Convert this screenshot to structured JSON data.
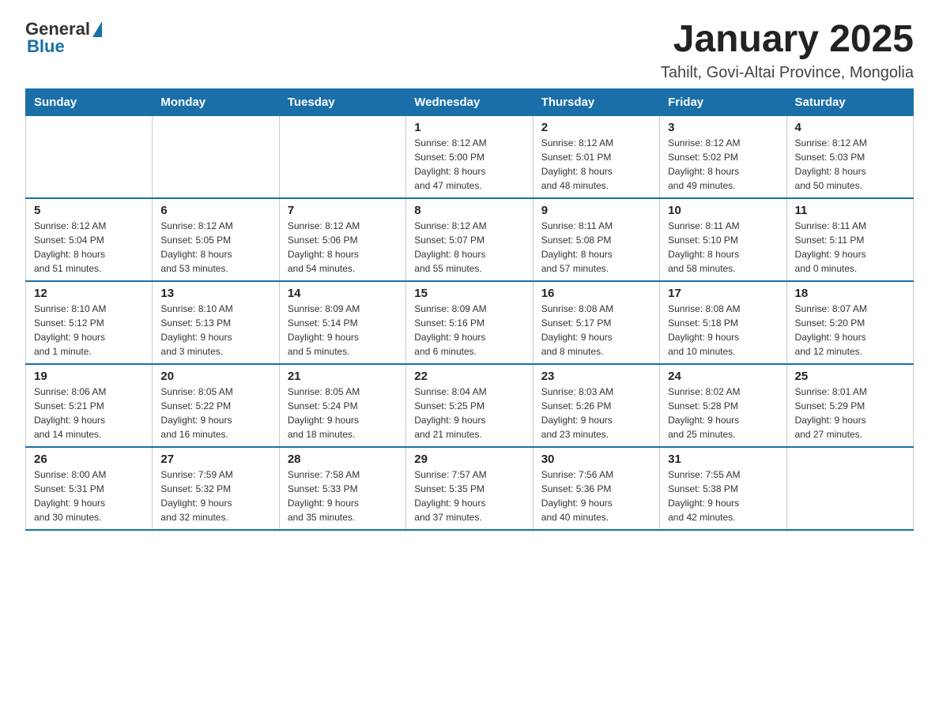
{
  "header": {
    "logo": {
      "general": "General",
      "blue": "Blue"
    },
    "title": "January 2025",
    "location": "Tahilt, Govi-Altai Province, Mongolia"
  },
  "days_of_week": [
    "Sunday",
    "Monday",
    "Tuesday",
    "Wednesday",
    "Thursday",
    "Friday",
    "Saturday"
  ],
  "weeks": [
    [
      {
        "day": "",
        "info": ""
      },
      {
        "day": "",
        "info": ""
      },
      {
        "day": "",
        "info": ""
      },
      {
        "day": "1",
        "info": "Sunrise: 8:12 AM\nSunset: 5:00 PM\nDaylight: 8 hours\nand 47 minutes."
      },
      {
        "day": "2",
        "info": "Sunrise: 8:12 AM\nSunset: 5:01 PM\nDaylight: 8 hours\nand 48 minutes."
      },
      {
        "day": "3",
        "info": "Sunrise: 8:12 AM\nSunset: 5:02 PM\nDaylight: 8 hours\nand 49 minutes."
      },
      {
        "day": "4",
        "info": "Sunrise: 8:12 AM\nSunset: 5:03 PM\nDaylight: 8 hours\nand 50 minutes."
      }
    ],
    [
      {
        "day": "5",
        "info": "Sunrise: 8:12 AM\nSunset: 5:04 PM\nDaylight: 8 hours\nand 51 minutes."
      },
      {
        "day": "6",
        "info": "Sunrise: 8:12 AM\nSunset: 5:05 PM\nDaylight: 8 hours\nand 53 minutes."
      },
      {
        "day": "7",
        "info": "Sunrise: 8:12 AM\nSunset: 5:06 PM\nDaylight: 8 hours\nand 54 minutes."
      },
      {
        "day": "8",
        "info": "Sunrise: 8:12 AM\nSunset: 5:07 PM\nDaylight: 8 hours\nand 55 minutes."
      },
      {
        "day": "9",
        "info": "Sunrise: 8:11 AM\nSunset: 5:08 PM\nDaylight: 8 hours\nand 57 minutes."
      },
      {
        "day": "10",
        "info": "Sunrise: 8:11 AM\nSunset: 5:10 PM\nDaylight: 8 hours\nand 58 minutes."
      },
      {
        "day": "11",
        "info": "Sunrise: 8:11 AM\nSunset: 5:11 PM\nDaylight: 9 hours\nand 0 minutes."
      }
    ],
    [
      {
        "day": "12",
        "info": "Sunrise: 8:10 AM\nSunset: 5:12 PM\nDaylight: 9 hours\nand 1 minute."
      },
      {
        "day": "13",
        "info": "Sunrise: 8:10 AM\nSunset: 5:13 PM\nDaylight: 9 hours\nand 3 minutes."
      },
      {
        "day": "14",
        "info": "Sunrise: 8:09 AM\nSunset: 5:14 PM\nDaylight: 9 hours\nand 5 minutes."
      },
      {
        "day": "15",
        "info": "Sunrise: 8:09 AM\nSunset: 5:16 PM\nDaylight: 9 hours\nand 6 minutes."
      },
      {
        "day": "16",
        "info": "Sunrise: 8:08 AM\nSunset: 5:17 PM\nDaylight: 9 hours\nand 8 minutes."
      },
      {
        "day": "17",
        "info": "Sunrise: 8:08 AM\nSunset: 5:18 PM\nDaylight: 9 hours\nand 10 minutes."
      },
      {
        "day": "18",
        "info": "Sunrise: 8:07 AM\nSunset: 5:20 PM\nDaylight: 9 hours\nand 12 minutes."
      }
    ],
    [
      {
        "day": "19",
        "info": "Sunrise: 8:06 AM\nSunset: 5:21 PM\nDaylight: 9 hours\nand 14 minutes."
      },
      {
        "day": "20",
        "info": "Sunrise: 8:05 AM\nSunset: 5:22 PM\nDaylight: 9 hours\nand 16 minutes."
      },
      {
        "day": "21",
        "info": "Sunrise: 8:05 AM\nSunset: 5:24 PM\nDaylight: 9 hours\nand 18 minutes."
      },
      {
        "day": "22",
        "info": "Sunrise: 8:04 AM\nSunset: 5:25 PM\nDaylight: 9 hours\nand 21 minutes."
      },
      {
        "day": "23",
        "info": "Sunrise: 8:03 AM\nSunset: 5:26 PM\nDaylight: 9 hours\nand 23 minutes."
      },
      {
        "day": "24",
        "info": "Sunrise: 8:02 AM\nSunset: 5:28 PM\nDaylight: 9 hours\nand 25 minutes."
      },
      {
        "day": "25",
        "info": "Sunrise: 8:01 AM\nSunset: 5:29 PM\nDaylight: 9 hours\nand 27 minutes."
      }
    ],
    [
      {
        "day": "26",
        "info": "Sunrise: 8:00 AM\nSunset: 5:31 PM\nDaylight: 9 hours\nand 30 minutes."
      },
      {
        "day": "27",
        "info": "Sunrise: 7:59 AM\nSunset: 5:32 PM\nDaylight: 9 hours\nand 32 minutes."
      },
      {
        "day": "28",
        "info": "Sunrise: 7:58 AM\nSunset: 5:33 PM\nDaylight: 9 hours\nand 35 minutes."
      },
      {
        "day": "29",
        "info": "Sunrise: 7:57 AM\nSunset: 5:35 PM\nDaylight: 9 hours\nand 37 minutes."
      },
      {
        "day": "30",
        "info": "Sunrise: 7:56 AM\nSunset: 5:36 PM\nDaylight: 9 hours\nand 40 minutes."
      },
      {
        "day": "31",
        "info": "Sunrise: 7:55 AM\nSunset: 5:38 PM\nDaylight: 9 hours\nand 42 minutes."
      },
      {
        "day": "",
        "info": ""
      }
    ]
  ]
}
